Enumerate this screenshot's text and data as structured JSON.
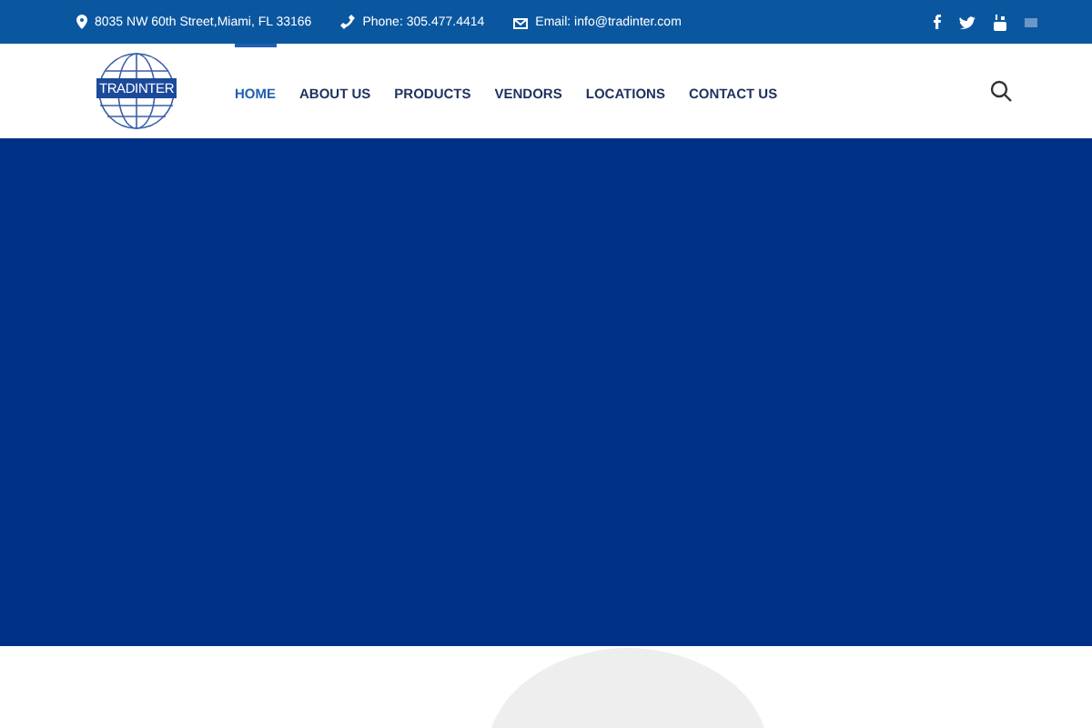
{
  "topbar": {
    "address": "8035 NW 60th Street,Miami, FL 33166",
    "phone": "Phone: 305.477.4414",
    "email": "Email: info@tradinter.com"
  },
  "logo": {
    "text": "TRADINTER"
  },
  "nav": [
    {
      "label": "HOME",
      "selected": true
    },
    {
      "label": "ABOUT US",
      "selected": false
    },
    {
      "label": "PRODUCTS",
      "selected": false
    },
    {
      "label": "VENDORS",
      "selected": false
    },
    {
      "label": "LOCATIONS",
      "selected": false
    },
    {
      "label": "CONTACT US",
      "selected": false
    }
  ]
}
